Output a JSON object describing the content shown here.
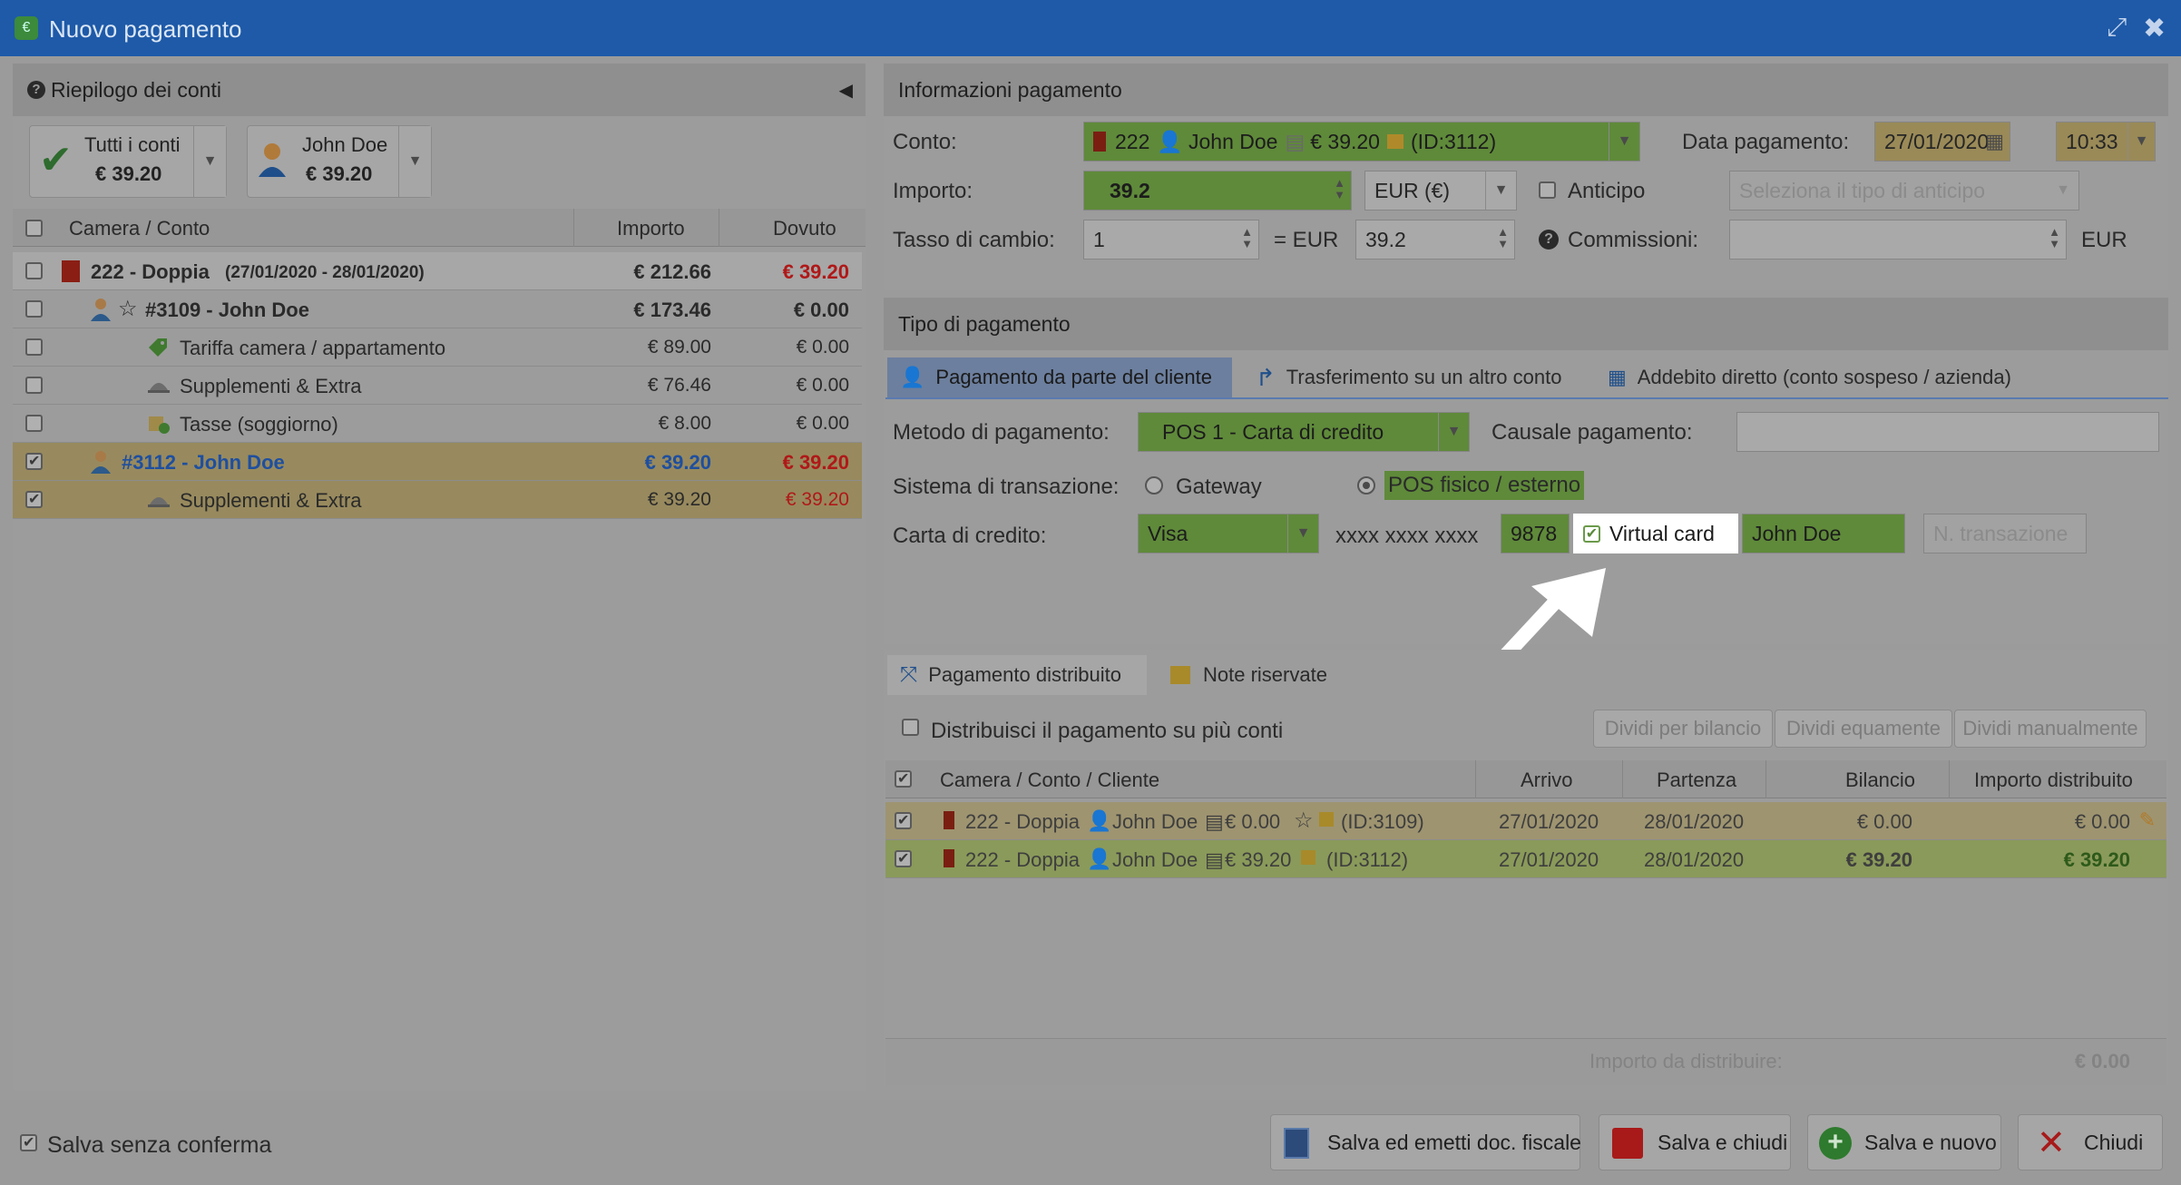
{
  "window": {
    "title": "Nuovo pagamento"
  },
  "left": {
    "header": "Riepilogo dei conti",
    "account_all": {
      "label": "Tutti i conti",
      "amount": "€ 39.20"
    },
    "account_person": {
      "label": "John Doe",
      "amount": "€ 39.20"
    },
    "columns": [
      "Camera / Conto",
      "Importo",
      "Dovuto"
    ],
    "rows": [
      {
        "label": "222 - Doppia",
        "dates": "(27/01/2020 - 28/01/2020)",
        "importo": "€ 212.66",
        "dovuto": "€ 39.20",
        "checked": false
      },
      {
        "label": "#3109 - John Doe",
        "importo": "€ 173.46",
        "dovuto": "€ 0.00",
        "checked": false
      },
      {
        "label": "Tariffa camera / appartamento",
        "importo": "€ 89.00",
        "dovuto": "€ 0.00",
        "checked": false
      },
      {
        "label": "Supplementi & Extra",
        "importo": "€ 76.46",
        "dovuto": "€ 0.00",
        "checked": false
      },
      {
        "label": "Tasse (soggiorno)",
        "importo": "€ 8.00",
        "dovuto": "€ 0.00",
        "checked": false
      },
      {
        "label": "#3112 - John Doe",
        "importo": "€ 39.20",
        "dovuto": "€ 39.20",
        "checked": true
      },
      {
        "label": "Supplementi & Extra",
        "importo": "€ 39.20",
        "dovuto": "€ 39.20",
        "checked": true
      }
    ]
  },
  "info": {
    "header": "Informazioni pagamento",
    "conto_label": "Conto:",
    "conto_value": {
      "room": "222",
      "person": "John Doe",
      "amount": "€ 39.20",
      "id": "(ID:3112)"
    },
    "data_label": "Data pagamento:",
    "data_value": "27/01/2020",
    "time_value": "10:33",
    "importo_label": "Importo:",
    "importo_value": "39.2",
    "currency": "EUR (€)",
    "anticipo_label": "Anticipo",
    "anticipo_placeholder": "Seleziona il tipo di anticipo",
    "tasso_label": "Tasso di cambio:",
    "tasso_value": "1",
    "eq_eur": "= EUR",
    "converted_value": "39.2",
    "commissioni_label": "Commissioni:",
    "commissioni_unit": "EUR"
  },
  "tipo": {
    "header": "Tipo di pagamento",
    "tabs": [
      "Pagamento da parte del cliente",
      "Trasferimento su un altro conto",
      "Addebito diretto (conto sospeso / azienda)"
    ],
    "metodo_label": "Metodo di pagamento:",
    "metodo_value": "POS 1 - Carta di credito",
    "causale_label": "Causale pagamento:",
    "sistema_label": "Sistema di transazione:",
    "gateway_label": "Gateway",
    "pos_label": "POS fisico / esterno",
    "carta_label": "Carta di credito:",
    "carta_value": "Visa",
    "card_mask": "xxxx xxxx xxxx",
    "card_last": "9878",
    "virtual_card": "Virtual card",
    "holder": "John Doe",
    "transazione_placeholder": "N. transazione"
  },
  "dist": {
    "tabs": [
      "Pagamento distribuito",
      "Note riservate"
    ],
    "distribuisci_label": "Distribuisci il pagamento su più conti",
    "btn_bilancio": "Dividi per bilancio",
    "btn_equamente": "Dividi equamente",
    "btn_manualmente": "Dividi manualmente",
    "columns": [
      "Camera / Conto / Cliente",
      "Arrivo",
      "Partenza",
      "Bilancio",
      "Importo distribuito"
    ],
    "rows": [
      {
        "room": "222 - Doppia",
        "person": "John Doe",
        "amount": "€ 0.00",
        "id": "(ID:3109)",
        "arrivo": "27/01/2020",
        "partenza": "28/01/2020",
        "bilancio": "€ 0.00",
        "distribuito": "€ 0.00"
      },
      {
        "room": "222 - Doppia",
        "person": "John Doe",
        "amount": "€ 39.20",
        "id": "(ID:3112)",
        "arrivo": "27/01/2020",
        "partenza": "28/01/2020",
        "bilancio": "€ 39.20",
        "distribuito": "€ 39.20"
      }
    ],
    "footer_label": "Importo da distribuire:",
    "footer_value": "€ 0.00"
  },
  "footer": {
    "salva_senza": "Salva senza conferma",
    "btn_fiscale": "Salva ed emetti doc. fiscale",
    "btn_chiudi_salva": "Salva e chiudi",
    "btn_nuovo": "Salva e nuovo",
    "btn_chiudi": "Chiudi"
  },
  "colors": {
    "title_bar": "#1e5aa8",
    "highlight_green": "#5f8a3a",
    "due_red": "#c21a1a",
    "link_blue": "#1e4fa0",
    "arrow": "#ffffff"
  }
}
